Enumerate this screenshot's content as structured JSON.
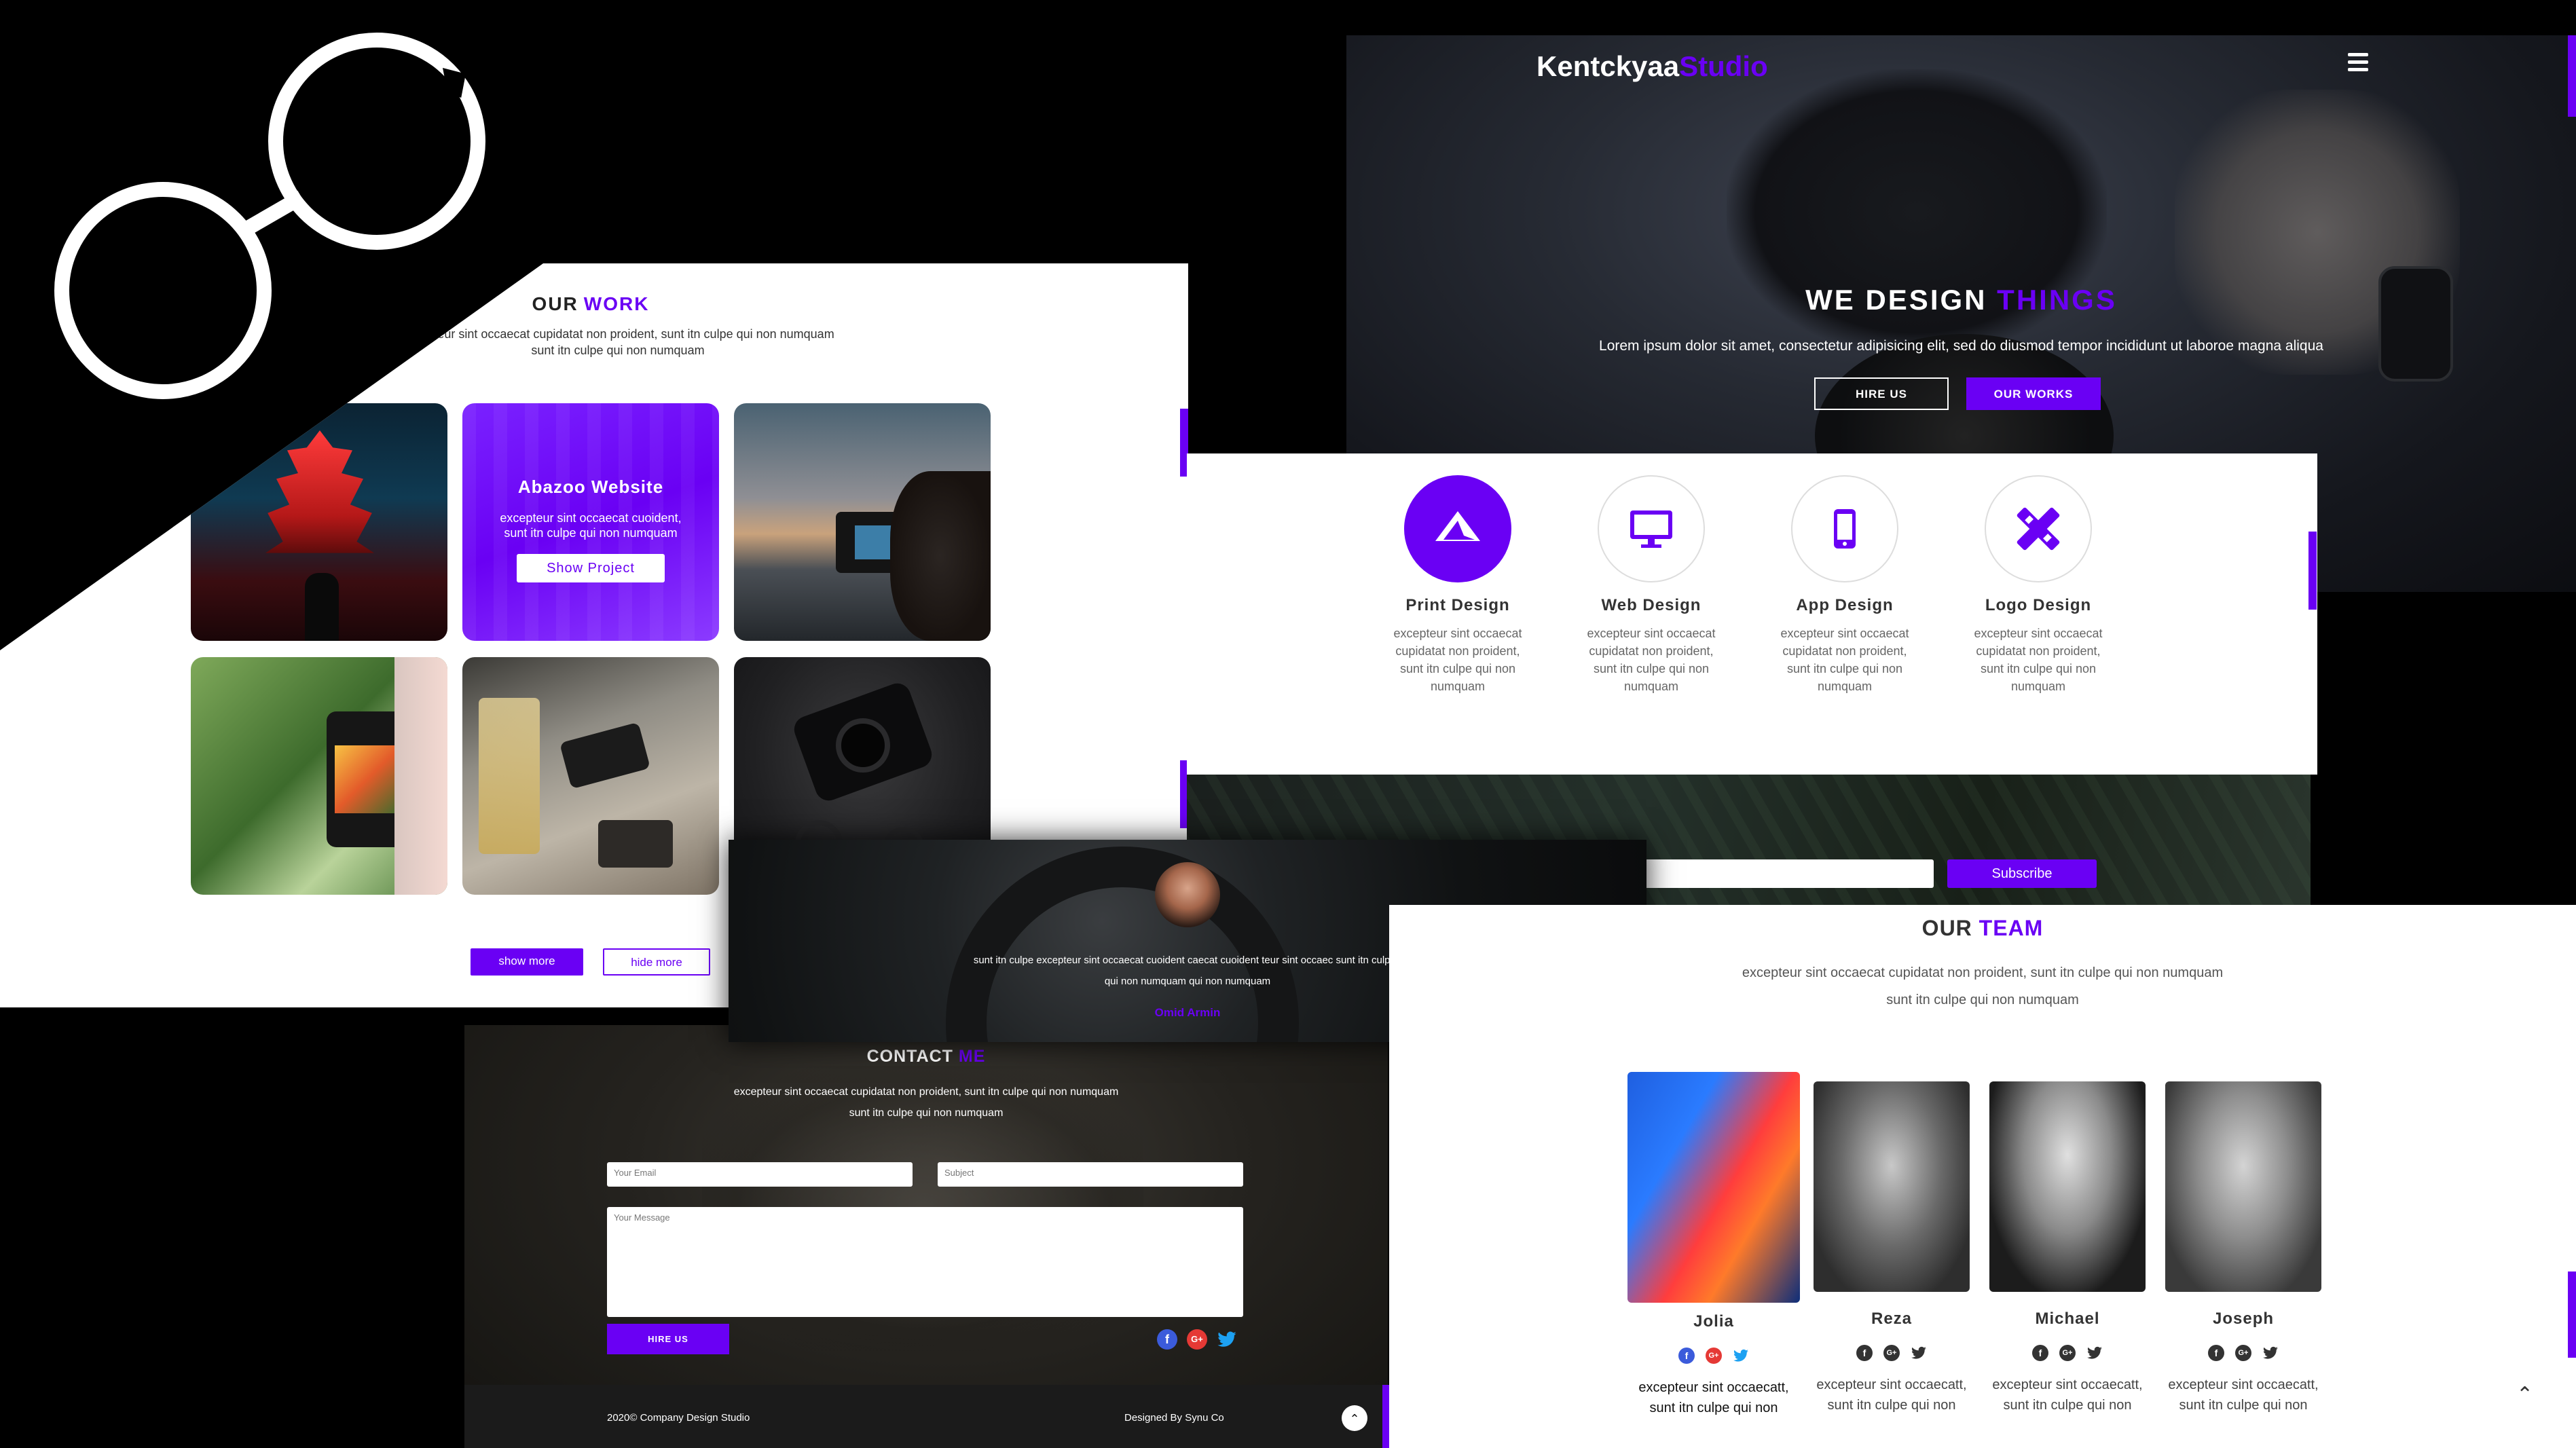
{
  "colors": {
    "accent": "#6a00f4",
    "background": "#000000"
  },
  "logo": {
    "icon": "glasses-logo-icon"
  },
  "work": {
    "title_a": "OUR",
    "title_b": "WORK",
    "subtitle_line1": "excepteur sint occaecat cupidatat non proident, sunt itn culpe qui non numquam",
    "subtitle_line2": "sunt itn culpe qui non numquam",
    "featured": {
      "title": "Abazoo Website",
      "desc_line1": "excepteur sint occaecat cuoident,",
      "desc_line2": "sunt itn culpe qui non numquam",
      "button": "Show Project"
    },
    "show_more": "show more",
    "hide_more": "hide more"
  },
  "hero": {
    "brand_a": "Kentckyaa",
    "brand_b": "Studio",
    "title_a": "WE DESIGN",
    "title_b": "THINGS",
    "desc": "Lorem ipsum dolor sit amet, consectetur adipisicing elit, sed do diusmod tempor incididunt ut laboroe magna aliqua",
    "btn_hire": "HIRE US",
    "btn_works": "OUR WORKS",
    "menu_icon": "hamburger-icon"
  },
  "services": [
    {
      "title": "Print Design",
      "icon": "paper-plane-icon",
      "desc": "excepteur sint occaecat cupidatat non proident, sunt itn culpe qui non numquam"
    },
    {
      "title": "Web Design",
      "icon": "monitor-icon",
      "desc": "excepteur sint occaecat cupidatat non proident, sunt itn culpe qui non numquam"
    },
    {
      "title": "App Design",
      "icon": "mobile-icon",
      "desc": "excepteur sint occaecat cupidatat non proident, sunt itn culpe qui non numquam"
    },
    {
      "title": "Logo Design",
      "icon": "pencil-ruler-icon",
      "desc": "excepteur sint occaecat cupidatat non proident, sunt itn culpe qui non numquam"
    }
  ],
  "subscribe": {
    "button": "Subscribe"
  },
  "testimonial": {
    "text_line1": "sunt itn culpe excepteur sint occaecat cuoident caecat cuoident teur sint occaec sunt itn culpe ,",
    "text_line2": "qui non numquam qui non numquam",
    "author": "Omid Armin"
  },
  "contact": {
    "title_a": "CONTACT",
    "title_b": "ME",
    "desc_line1": "excepteur sint occaecat cupidatat non proident, sunt itn culpe qui non numquam",
    "desc_line2": "sunt itn culpe qui non numquam",
    "email_placeholder": "Your Email",
    "subject_placeholder": "Subject",
    "message_placeholder": "Your Message",
    "button": "HIRE US",
    "copyright": "2020© Company Design Studio",
    "designed_by": "Designed By Synu Co"
  },
  "team": {
    "title_a": "OUR",
    "title_b": "TEAM",
    "desc_line1": "excepteur sint occaecat cupidatat non proident, sunt itn culpe qui non numquam",
    "desc_line2": "sunt itn culpe qui non numquam",
    "members": [
      {
        "name": "Jolia",
        "desc_line1": "excepteur sint occaecatt,",
        "desc_line2": "sunt itn culpe qui non"
      },
      {
        "name": "Reza",
        "desc_line1": "excepteur sint occaecatt,",
        "desc_line2": "sunt itn culpe qui non"
      },
      {
        "name": "Michael",
        "desc_line1": "excepteur sint occaecatt,",
        "desc_line2": "sunt itn culpe qui non"
      },
      {
        "name": "Joseph",
        "desc_line1": "excepteur sint occaecatt,",
        "desc_line2": "sunt itn culpe qui non"
      }
    ]
  }
}
